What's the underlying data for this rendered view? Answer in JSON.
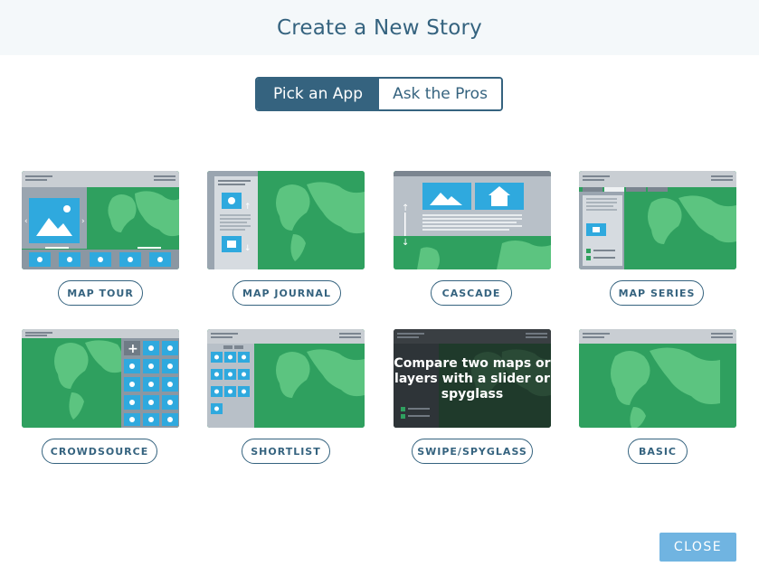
{
  "dialog": {
    "title": "Create a New Story"
  },
  "tabs": [
    {
      "label": "Pick an App",
      "active": true
    },
    {
      "label": "Ask the Pros",
      "active": false
    }
  ],
  "apps": [
    {
      "label": "MAP TOUR"
    },
    {
      "label": "MAP JOURNAL"
    },
    {
      "label": "CASCADE"
    },
    {
      "label": "MAP SERIES"
    },
    {
      "label": "CROWDSOURCE"
    },
    {
      "label": "SHORTLIST"
    },
    {
      "label": "SWIPE/SPYGLASS",
      "overlay_text": "Compare two maps or layers with a slider or spyglass"
    },
    {
      "label": "BASIC"
    }
  ],
  "footer": {
    "close_label": "CLOSE"
  },
  "colors": {
    "primary": "#35637f",
    "map_green": "#2fa05f",
    "land_green": "#5cc480",
    "accent_blue": "#2fa9de",
    "panel_gray": "#b8c0c8",
    "close_button": "#70b4e1"
  }
}
